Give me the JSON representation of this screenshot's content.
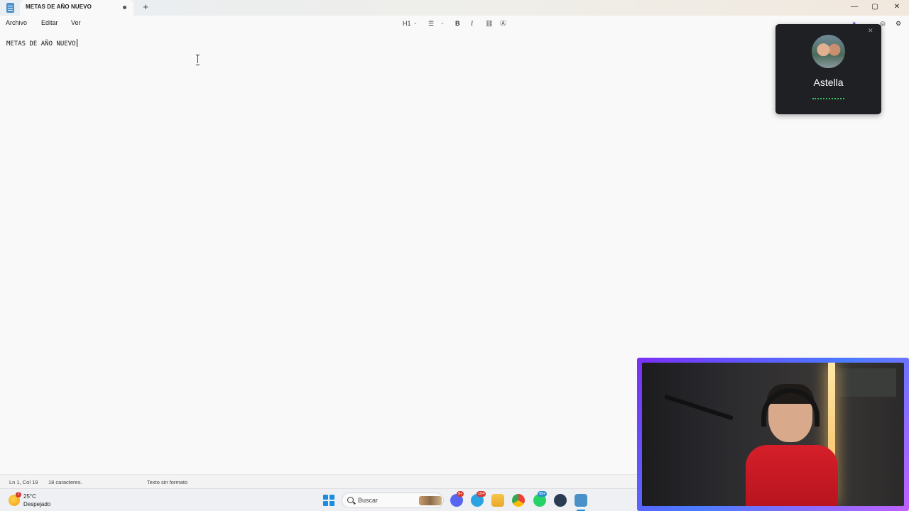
{
  "tab": {
    "title": "METAS DE AÑO NUEVO",
    "new_tab_label": "+"
  },
  "window_controls": {
    "minimize": "—",
    "maximize": "▢",
    "close": "✕"
  },
  "menu": {
    "items": [
      "Archivo",
      "Editar",
      "Ver"
    ]
  },
  "toolbar": {
    "heading_label": "H1",
    "bold": "B",
    "italic": "I"
  },
  "editor": {
    "content": "METAS DE AÑO NUEVO"
  },
  "status": {
    "position": "Ln 1, Col 19",
    "characters": "18 caracteres.",
    "format": "Texto sin formato"
  },
  "call_popup": {
    "name": "Astella",
    "close": "✕"
  },
  "taskbar": {
    "weather": {
      "badge": "7",
      "temp": "25°C",
      "condition": "Despejado"
    },
    "search_placeholder": "Buscar",
    "badges": {
      "discord": "9+",
      "telegram": "104",
      "whatsapp": "99+"
    }
  },
  "colors": {
    "accent": "#1c8ce0",
    "call_bg": "#1e2024",
    "call_progress": "#36c06a",
    "webcam_border": "#7b2ff7"
  },
  "icons": [
    "notepad-icon",
    "list-icon",
    "link-icon",
    "clear-format-icon",
    "copilot-icon",
    "profile-icon",
    "settings-icon",
    "windows-start-icon",
    "discord-icon",
    "telegram-icon",
    "file-explorer-icon",
    "chrome-icon",
    "whatsapp-icon",
    "steam-icon",
    "notepad-taskbar-icon"
  ]
}
